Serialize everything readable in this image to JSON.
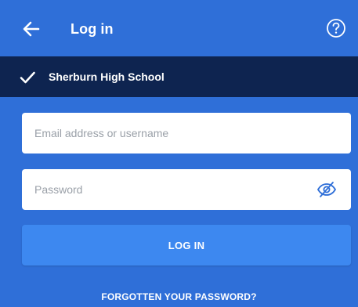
{
  "appbar": {
    "title": "Log in",
    "back_icon": "arrow-left-icon",
    "help_icon": "question-circle-icon"
  },
  "school": {
    "name": "Sherburn High School",
    "icon": "check-icon"
  },
  "form": {
    "email": {
      "placeholder": "Email address or username",
      "value": ""
    },
    "password": {
      "placeholder": "Password",
      "value": "",
      "toggle_icon": "eye-slash-icon"
    },
    "login_label": "LOG IN",
    "forgot_label": "FORGOTTEN YOUR PASSWORD?"
  },
  "colors": {
    "background": "#2f6fd8",
    "school_bar": "#0e2450",
    "button": "#3d88f0",
    "eye_icon": "#2f6fd8"
  }
}
